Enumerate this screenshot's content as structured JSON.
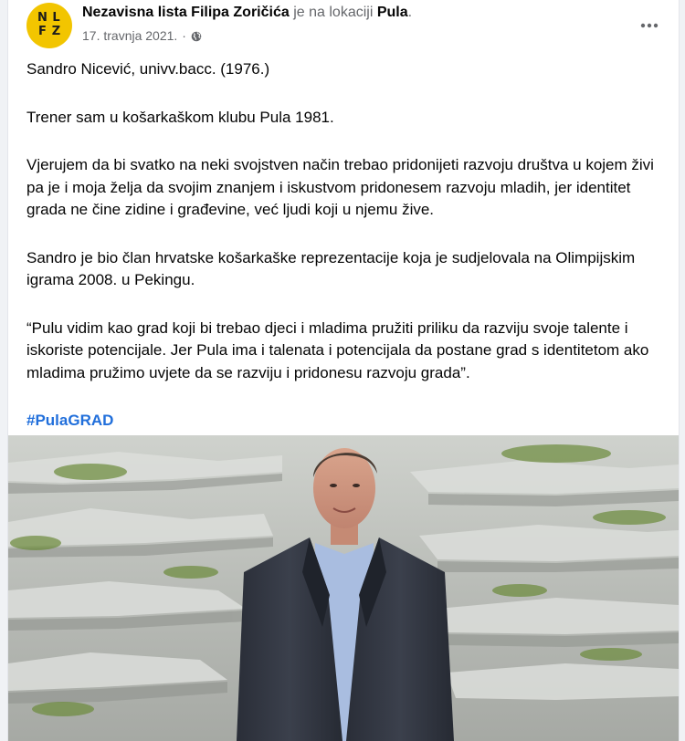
{
  "header": {
    "page_name": "Nezavisna lista Filipa Zoričića",
    "location_prefix": "je na lokaciji",
    "location": "Pula",
    "location_suffix": ".",
    "date": "17. travnja 2021.",
    "date_separator": "·",
    "avatar_letters": [
      "N",
      "L",
      "F",
      "Z"
    ],
    "more_icon": "more-horizontal-icon",
    "privacy_icon": "globe-icon"
  },
  "post": {
    "paragraphs": [
      "Sandro Nicević, univv.bacc. (1976.)",
      "Trener sam u košarkaškom klubu Pula 1981.",
      "Vjerujem da bi svatko na neki svojstven način trebao pridonijeti razvoju društva u kojem živi pa je i moja želja da svojim znanjem i iskustvom pridonesem razvoju mladih, jer identitet grada ne čine zidine i građevine, već ljudi koji u njemu žive.",
      "Sandro je bio član hrvatske košarkaške reprezentacije koja je sudjelovala na Olimpijskim igrama 2008. u Pekingu.",
      "“Pulu vidim kao grad koji bi trebao djeci i mladima pružiti priliku da razviju svoje talente i iskoriste potencijale. Jer Pula ima i talenata i potencijala da postane grad s identitetom ako mladima pružimo uvjete da se razviju i pridonesu razvoju grada”."
    ],
    "hashtag": "#PulaGRAD"
  },
  "colors": {
    "avatar_bg": "#f2c500",
    "hashtag": "#216fdb",
    "text": "#050505",
    "secondary_text": "#65676b"
  }
}
